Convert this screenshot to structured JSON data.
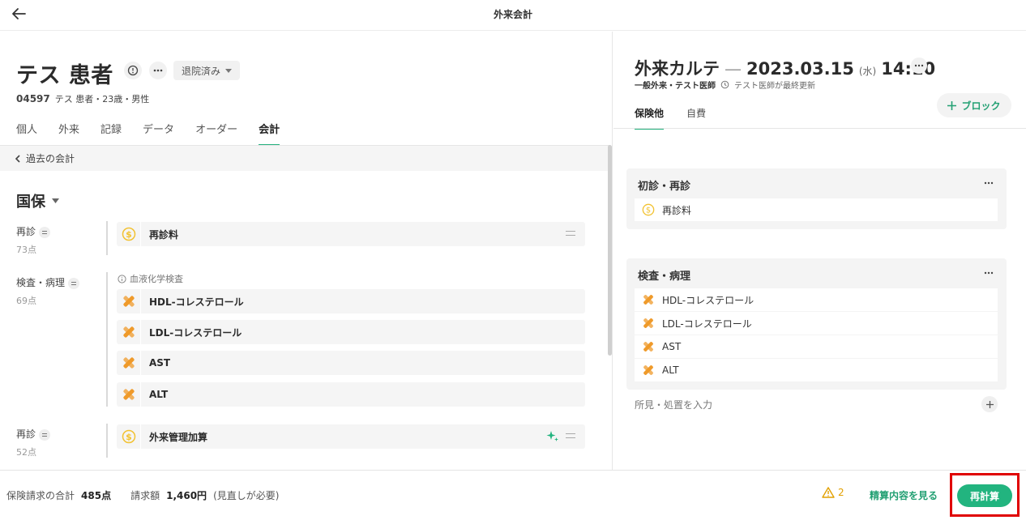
{
  "window": {
    "title": "外来会計"
  },
  "patient": {
    "name": "テス 患者",
    "status": "退院済み",
    "id": "04597",
    "meta": "テス 患者・23歳・男性"
  },
  "tabs": [
    {
      "label": "個人"
    },
    {
      "label": "外来"
    },
    {
      "label": "記録"
    },
    {
      "label": "データ"
    },
    {
      "label": "オーダー"
    },
    {
      "label": "会計",
      "active": true
    }
  ],
  "past_link": "過去の会計",
  "insurance": "国保",
  "groups": [
    {
      "category": "再診",
      "points": "73点",
      "items": [
        "再診料"
      ]
    },
    {
      "category": "検査・病理",
      "points": "69点",
      "note": "血液化学検査",
      "items": [
        "HDL-コレステロール",
        "LDL-コレステロール",
        "AST",
        "ALT"
      ]
    },
    {
      "category": "再診",
      "points": "52点",
      "items": [
        "外来管理加算"
      ]
    }
  ],
  "chart": {
    "title": "外来カルテ",
    "date": "2023.03.15",
    "dow": "(水)",
    "time": "14:10",
    "dept": "一般外来・テスト医師",
    "updated": "テスト医師が最終更新",
    "tabs": [
      "保険他",
      "自費"
    ],
    "block_button": "ブロック",
    "cards": [
      {
        "title": "初診・再診",
        "items": [
          "再診料"
        ]
      },
      {
        "title": "検査・病理",
        "items": [
          "HDL-コレステロール",
          "LDL-コレステロール",
          "AST",
          "ALT"
        ]
      }
    ],
    "findings_placeholder": "所見・処置を入力"
  },
  "footer": {
    "total_label": "保険請求の合計",
    "total_value": "485点",
    "bill_label": "請求額",
    "bill_value": "1,460円",
    "bill_note": "(見直しが必要)",
    "warning_count": "2",
    "view_button": "精算内容を見る",
    "recalc_button": "再計算"
  },
  "colors": {
    "accent": "#22b47f",
    "highlight": "#e00000",
    "warning": "#e2a000",
    "coin": "#f2c232",
    "test": "#ef9a2a"
  }
}
